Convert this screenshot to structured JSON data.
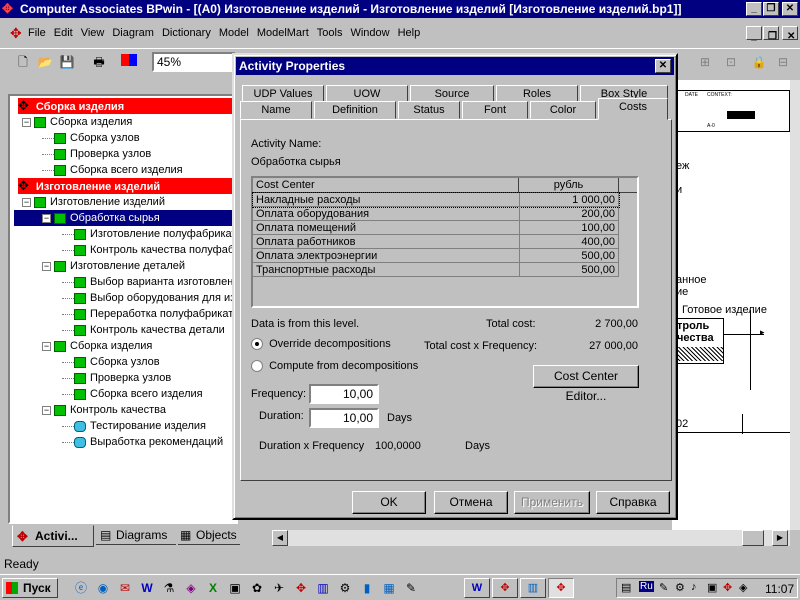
{
  "window": {
    "title": "Computer Associates BPwin - [(A0) Изготовление изделий - Изготовление изделий  [Изготовление изделий.bp1]]"
  },
  "menu": [
    "File",
    "Edit",
    "View",
    "Diagram",
    "Dictionary",
    "Model",
    "ModelMart",
    "Tools",
    "Window",
    "Help"
  ],
  "toolbar": {
    "zoom": "45%"
  },
  "tree": {
    "items": [
      {
        "label": "Сборка изделия",
        "level": 0,
        "type": "header"
      },
      {
        "label": "Сборка изделия",
        "level": 1
      },
      {
        "label": "Сборка узлов",
        "level": 2
      },
      {
        "label": "Проверка узлов",
        "level": 2
      },
      {
        "label": "Сборка всего изделия",
        "level": 2
      },
      {
        "label": "Изготовление изделий",
        "level": 0,
        "type": "header"
      },
      {
        "label": "Изготовление изделий",
        "level": 1
      },
      {
        "label": "Обработка  сырья",
        "level": 2,
        "type": "selected"
      },
      {
        "label": "Изготовление полуфабрикат",
        "level": 3
      },
      {
        "label": "Контроль качества полуфаб",
        "level": 3
      },
      {
        "label": "Изготовление  деталей",
        "level": 2
      },
      {
        "label": "Выбор  варианта изготовлен",
        "level": 3
      },
      {
        "label": "Выбор оборудования для из",
        "level": 3
      },
      {
        "label": "Переработка полуфабриката",
        "level": 3
      },
      {
        "label": "Контроль качества детали",
        "level": 3
      },
      {
        "label": "Сборка изделия",
        "level": 2
      },
      {
        "label": "Сборка узлов",
        "level": 3
      },
      {
        "label": "Проверка узлов",
        "level": 3
      },
      {
        "label": "Сборка всего изделия",
        "level": 3
      },
      {
        "label": "Контроль качества",
        "level": 2
      },
      {
        "label": "Тестирование изделия",
        "level": 3,
        "icon": "cyan"
      },
      {
        "label": "Выработка рекомендаций",
        "level": 3,
        "icon": "cyan"
      }
    ]
  },
  "bottom_tabs": [
    "Activi...",
    "Diagrams",
    "Objects"
  ],
  "diagram_fragments": {
    "date_label": "DATE",
    "context_label": "CONTEXT:",
    "a0_label": "A-0",
    "text1": "еж",
    "text2": "и",
    "text3": "анное",
    "text4": "ие",
    "text5": "Готовое изделие",
    "box_line1": "троль",
    "box_line2": "чества",
    "node_num": "02"
  },
  "dialog": {
    "title": "Activity Properties",
    "tabs_back": [
      "UDP Values",
      "UOW",
      "Source",
      "Roles",
      "Box Style"
    ],
    "tabs_front": [
      "Name",
      "Definition",
      "Status",
      "Font",
      "Color",
      "Costs"
    ],
    "active_tab": "Costs",
    "activity_name_label": "Activity Name:",
    "activity_name": "Обработка  сырья",
    "grid_headers": [
      "Cost Center",
      "рубль"
    ],
    "cost_centers": [
      {
        "name": "Накладные расходы",
        "value": "1 000,00"
      },
      {
        "name": "Оплата оборудования",
        "value": "200,00"
      },
      {
        "name": "Оплата помещений",
        "value": "100,00"
      },
      {
        "name": "Оплата работников",
        "value": "400,00"
      },
      {
        "name": "Оплата электроэнергии",
        "value": "500,00"
      },
      {
        "name": "Транспортные расходы",
        "value": "500,00"
      }
    ],
    "data_source": "Data is from this level.",
    "total_cost_label": "Total cost:",
    "total_cost": "2 700,00",
    "total_freq_label": "Total cost x Frequency:",
    "total_freq": "27 000,00",
    "radio_override": "Override decompositions",
    "radio_compute": "Compute from decompositions",
    "cost_center_editor": "Cost Center Editor...",
    "frequency_label": "Frequency:",
    "frequency": "10,00",
    "duration_label": "Duration:",
    "duration": "10,00",
    "days": "Days",
    "duration_freq_label": "Duration x Frequency",
    "duration_freq": "100,0000",
    "duration_freq_unit": "Days",
    "buttons": {
      "ok": "OK",
      "cancel": "Отмена",
      "apply": "Применить",
      "help": "Справка"
    }
  },
  "status": {
    "text": "Ready"
  },
  "taskbar": {
    "start": "Пуск",
    "clock": "11:07",
    "lang": "Ru"
  }
}
